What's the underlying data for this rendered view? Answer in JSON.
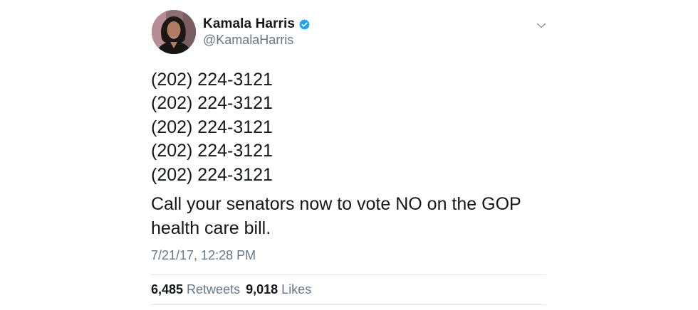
{
  "author": {
    "display_name": "Kamala Harris",
    "handle": "@KamalaHarris",
    "verified": true,
    "avatar_icon": "profile-photo",
    "verified_icon": "verified-badge-icon",
    "verified_color": "#1da1f2"
  },
  "tweet": {
    "phone_lines": [
      "(202) 224-3121",
      "(202) 224-3121",
      "(202) 224-3121",
      "(202) 224-3121",
      "(202) 224-3121"
    ],
    "message": "Call your senators now to vote NO on the GOP health care bill.",
    "timestamp": "7/21/17, 12:28 PM"
  },
  "stats": {
    "retweets_count": "6,485",
    "retweets_label": "Retweets",
    "likes_count": "9,018",
    "likes_label": "Likes"
  },
  "menu_icon": "chevron-down-icon"
}
